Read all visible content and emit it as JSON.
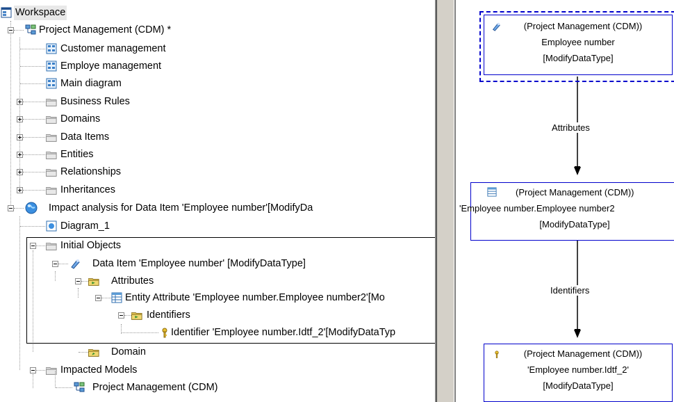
{
  "tree": {
    "workspace": "Workspace",
    "project_model": "Project Management (CDM) *",
    "diagrams": [
      "Customer management",
      "Employe management",
      "Main diagram"
    ],
    "folders": [
      "Business Rules",
      "Domains",
      "Data Items",
      "Entities",
      "Relationships",
      "Inheritances"
    ],
    "impact_analysis": "Impact analysis for Data Item 'Employee number'[ModifyDa",
    "diagram_1": "Diagram_1",
    "initial_objects": "Initial Objects",
    "data_item": "Data Item 'Employee number' [ModifyDataType]",
    "attributes": "Attributes",
    "entity_attribute": "Entity Attribute 'Employee number.Employee number2'[Mo",
    "identifiers": "Identifiers",
    "identifier": "Identifier 'Employee number.Idtf_2'[ModifyDataTyp",
    "domain": "Domain",
    "impacted_models": "Impacted Models",
    "impacted_project": "Project Management (CDM)"
  },
  "diagram": {
    "node1": {
      "line1": "(Project Management (CDM))",
      "line2": "Employee number",
      "line3": "[ModifyDataType]"
    },
    "edge1": "Attributes",
    "node2": {
      "line1": "(Project Management (CDM))",
      "line2": "'Employee number.Employee number2",
      "line3": "[ModifyDataType]"
    },
    "edge2": "Identifiers",
    "node3": {
      "line1": "(Project Management (CDM))",
      "line2": "'Employee number.Idtf_2'",
      "line3": "[ModifyDataType]"
    }
  },
  "colors": {
    "node_border": "#0000cc",
    "folder": "#d8d8d8",
    "splitter": "#d4d0c8"
  }
}
